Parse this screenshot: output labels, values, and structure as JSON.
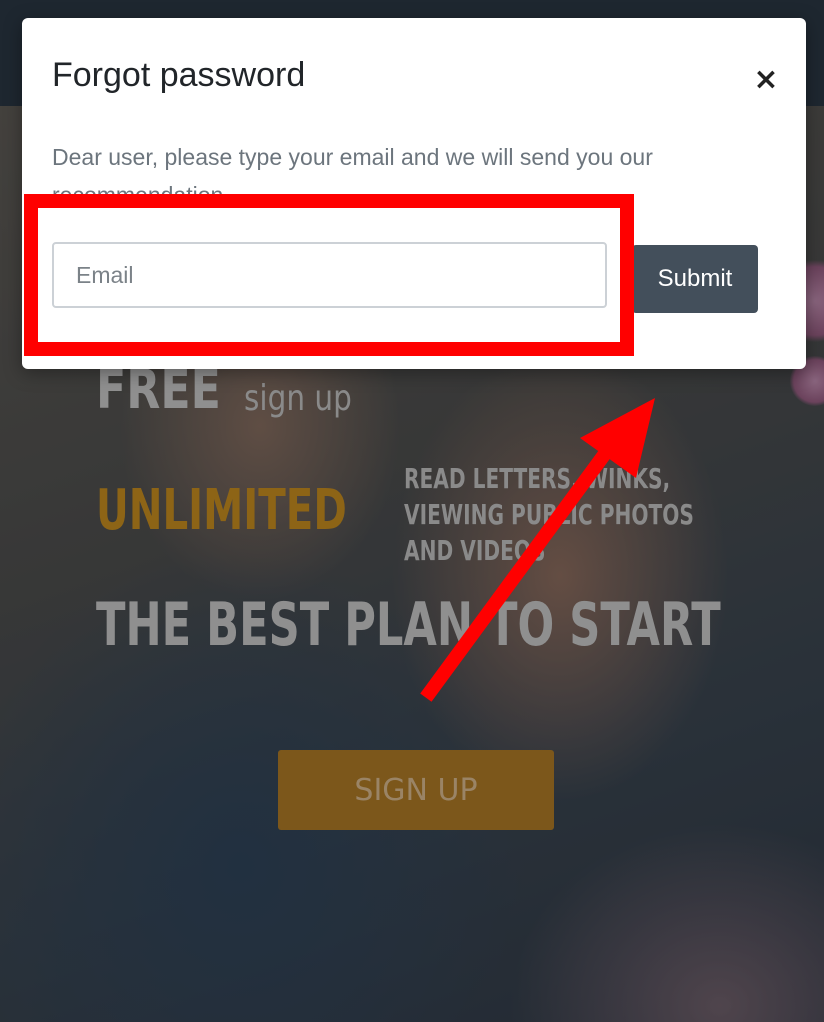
{
  "background_page": {
    "hero": {
      "free_label": "FREE",
      "signup_small_label": "sign up",
      "unlimited_label": "UNLIMITED",
      "read_letters_text": "READ LETTERS, WINKS,\nVIEWING PUBLIC PHOTOS\nAND VIDEOS",
      "best_plan_label": "THE BEST PLAN TO START",
      "signup_button_label": "SIGN UP"
    }
  },
  "modal": {
    "title": "Forgot password",
    "close_label": "×",
    "description": "Dear user, please type your email and we will send you our recommendation",
    "email": {
      "placeholder": "Email",
      "value": ""
    },
    "submit_label": "Submit"
  },
  "annotation": {
    "highlight_color": "#ff0000",
    "target": "email-input"
  },
  "colors": {
    "modal_bg": "#ffffff",
    "submit_bg": "#434f5b",
    "accent_gold": "#8d6416",
    "topbar_bg": "#1e2730"
  }
}
